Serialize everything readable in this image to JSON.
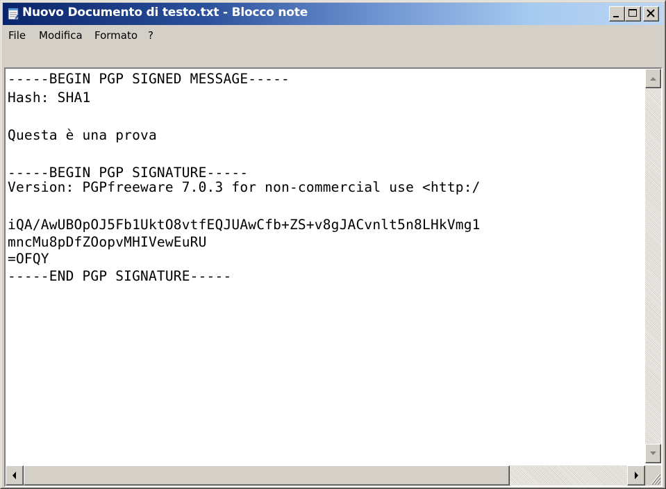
{
  "window": {
    "title": "Nuovo Documento di testo.txt - Blocco note",
    "icon": "notepad-icon"
  },
  "caption_buttons": {
    "minimize": "minimize-icon",
    "maximize": "maximize-icon",
    "close": "close-icon"
  },
  "menu": {
    "items": [
      {
        "label": "File"
      },
      {
        "label": "Modifica"
      },
      {
        "label": "Formato"
      },
      {
        "label": "?"
      }
    ]
  },
  "document": {
    "lines": [
      "-----BEGIN PGP SIGNED MESSAGE-----",
      "Hash: SHA1",
      "",
      "Questa è una prova",
      "",
      "-----BEGIN PGP SIGNATURE-----",
      "Version: PGPfreeware 7.0.3 for non-commercial use <http:/",
      "",
      "iQA/AwUBOpOJ5Fb1UktO8vtfEQJUAwCfb+ZS+v8gJACvnlt5n8LHkVmg1",
      "mncMu8pDfZOopvMHIVewEuRU",
      "=OFQY",
      "-----END PGP SIGNATURE-----"
    ]
  },
  "colors": {
    "title_active": "#0a246a",
    "title_gradient_end": "#a6caf0",
    "face": "#d4d0c8"
  }
}
